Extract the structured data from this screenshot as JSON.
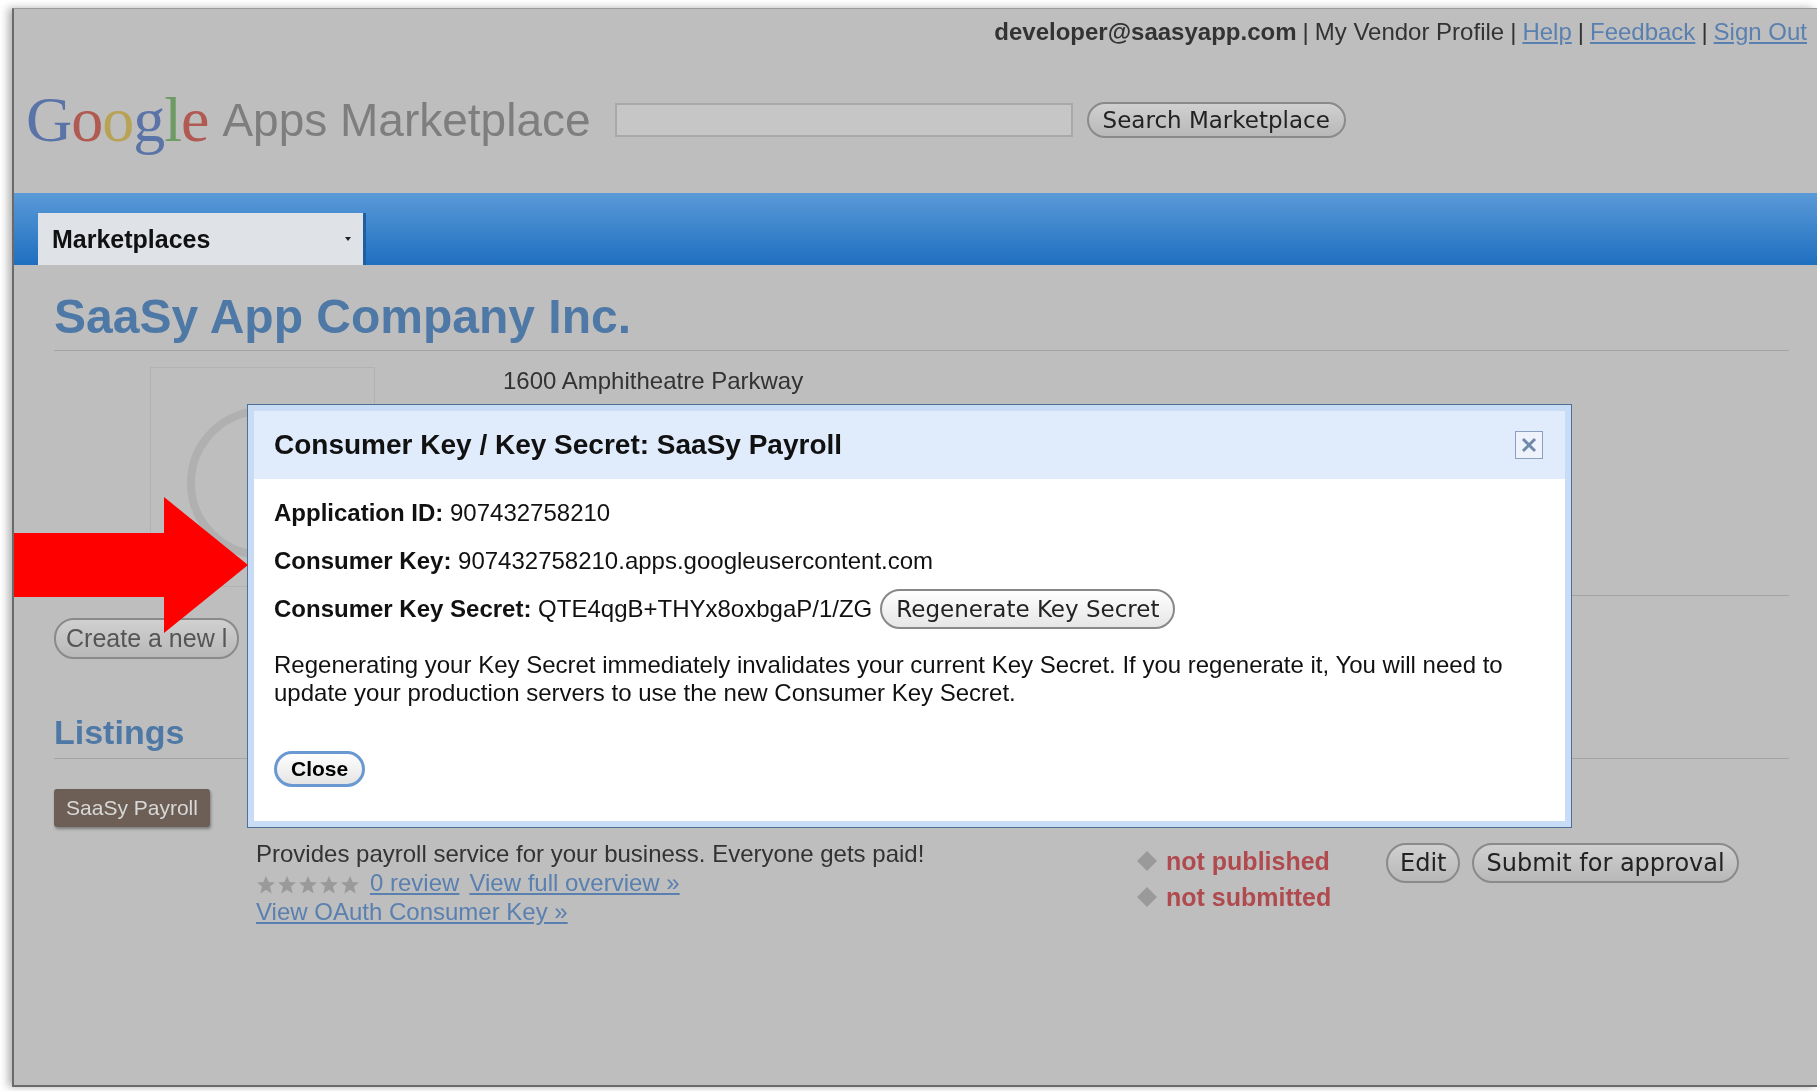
{
  "top_bar": {
    "separator": "|",
    "links": [
      {
        "text": "developer@saasyapp.com",
        "kind": "account"
      },
      {
        "text": "My Vendor Profile",
        "kind": "plain"
      },
      {
        "text": "Help",
        "kind": "link"
      },
      {
        "text": "Feedback",
        "kind": "link"
      },
      {
        "text": "Sign Out",
        "kind": "link"
      }
    ]
  },
  "header": {
    "logo": "Google",
    "product": "Apps Marketplace",
    "search_button": "Search Marketplace"
  },
  "nav": {
    "tabs": [
      {
        "label": "Marketplaces",
        "selected": true
      }
    ]
  },
  "company": {
    "name": "SaaSy App Company Inc.",
    "address": "1600 Amphitheatre Parkway",
    "create_button": "Create a new l"
  },
  "listings": {
    "title": "Listings",
    "items": [
      {
        "badge": "SaaSy Payroll",
        "description": "Provides payroll service for your business. Everyone gets paid!",
        "stars": 0,
        "review_link": "0 review",
        "overview_link": "View full overview »",
        "oauth_link": "View OAuth Consumer Key »",
        "statuses": [
          "not published",
          "not submitted"
        ],
        "actions": [
          "Edit",
          "Submit for approval"
        ]
      }
    ]
  },
  "dialog": {
    "title": "Consumer Key / Key Secret: SaaSy Payroll",
    "fields": [
      {
        "label": "Application ID:",
        "value": "907432758210"
      },
      {
        "label": "Consumer Key:",
        "value": "907432758210.apps.googleusercontent.com"
      },
      {
        "label": "Consumer Key Secret:",
        "value": "QTE4qgB+THYx8oxbgaP/1/ZG",
        "button": "Regenerate Key Secret"
      }
    ],
    "note": "Regenerating your Key Secret immediately invalidates your current Key Secret. If you regenerate it, You will need to update your production servers to use the new Consumer Key Secret.",
    "close_button": "Close"
  }
}
